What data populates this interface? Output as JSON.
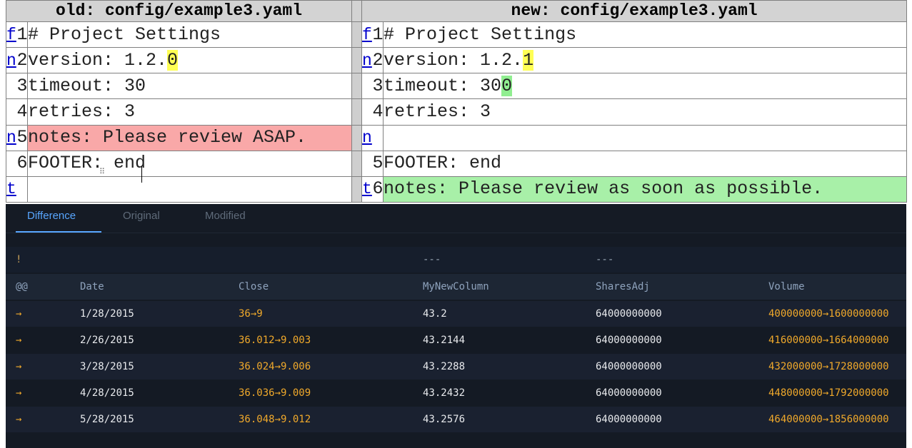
{
  "top_diff": {
    "old_header": "old: config/example3.yaml",
    "new_header": "new: config/example3.yaml",
    "rows": [
      {
        "left_nav": "f",
        "left_ln": "1",
        "left_pre": "# Project Settings",
        "left_hl": "",
        "left_post": "",
        "left_cls": "",
        "right_nav": "f",
        "right_ln": "1",
        "right_pre": "# Project Settings",
        "right_hl": "",
        "right_post": "",
        "right_cls": ""
      },
      {
        "left_nav": "n",
        "left_ln": "2",
        "left_pre": "version: 1.2.",
        "left_hl": "0",
        "left_post": "",
        "left_cls": "",
        "right_nav": "n",
        "right_ln": "2",
        "right_pre": "version: 1.2.",
        "right_hl": "1",
        "right_post": "",
        "right_cls": ""
      },
      {
        "left_nav": "",
        "left_ln": "3",
        "left_pre": "timeout: 30",
        "left_hl": "",
        "left_post": "",
        "left_cls": "",
        "right_nav": "",
        "right_ln": "3",
        "right_pre": "timeout: 30",
        "right_hl": "0",
        "right_post": "",
        "right_cls": "green"
      },
      {
        "left_nav": "",
        "left_ln": "4",
        "left_pre": "retries: 3",
        "left_hl": "",
        "left_post": "",
        "left_cls": "",
        "right_nav": "",
        "right_ln": "4",
        "right_pre": "retries: 3",
        "right_hl": "",
        "right_post": "",
        "right_cls": ""
      },
      {
        "left_nav": "n",
        "left_ln": "5",
        "left_pre": "notes: Please review ASAP.",
        "left_hl": "",
        "left_post": "",
        "left_cls": "del",
        "right_nav": "n",
        "right_ln": "",
        "right_pre": "",
        "right_hl": "",
        "right_post": "",
        "right_cls": ""
      },
      {
        "left_nav": "",
        "left_ln": "6",
        "left_pre": "FOOTER: end",
        "left_hl": "",
        "left_post": "",
        "left_cls": "",
        "right_nav": "",
        "right_ln": "5",
        "right_pre": "FOOTER: end",
        "right_hl": "",
        "right_post": "",
        "right_cls": ""
      },
      {
        "left_nav": "t",
        "left_ln": "",
        "left_pre": "",
        "left_hl": "",
        "left_post": "",
        "left_cls": "",
        "right_nav": "t",
        "right_ln": "6",
        "right_pre": "notes: Please review as soon as possible.",
        "right_hl": "",
        "right_post": "",
        "right_cls": "add"
      }
    ]
  },
  "tabs": {
    "difference": "Difference",
    "original": "Original",
    "modified": "Modified"
  },
  "grid": {
    "bang_row": [
      "!",
      "",
      "",
      "---",
      "---",
      ""
    ],
    "headers": [
      "@@",
      "Date",
      "Close",
      "MyNewColumn",
      "SharesAdj",
      "Volume"
    ],
    "rows": [
      {
        "marker": "→",
        "date": "1/28/2015",
        "close": "36→9",
        "mynew": "43.2",
        "shares": "64000000000",
        "volume": "400000000→1600000000"
      },
      {
        "marker": "→",
        "date": "2/26/2015",
        "close": "36.012→9.003",
        "mynew": "43.2144",
        "shares": "64000000000",
        "volume": "416000000→1664000000"
      },
      {
        "marker": "→",
        "date": "3/28/2015",
        "close": "36.024→9.006",
        "mynew": "43.2288",
        "shares": "64000000000",
        "volume": "432000000→1728000000"
      },
      {
        "marker": "→",
        "date": "4/28/2015",
        "close": "36.036→9.009",
        "mynew": "43.2432",
        "shares": "64000000000",
        "volume": "448000000→1792000000"
      },
      {
        "marker": "→",
        "date": "5/28/2015",
        "close": "36.048→9.012",
        "mynew": "43.2576",
        "shares": "64000000000",
        "volume": "464000000→1856000000"
      }
    ]
  },
  "colors": {
    "deleted_line": "#f9a8a8",
    "added_line": "#a8f0a8",
    "changed_char": "#ffff55",
    "panel_bg": "#141a24",
    "active_tab": "#58a6ff",
    "changed_value": "#f0a92b"
  }
}
